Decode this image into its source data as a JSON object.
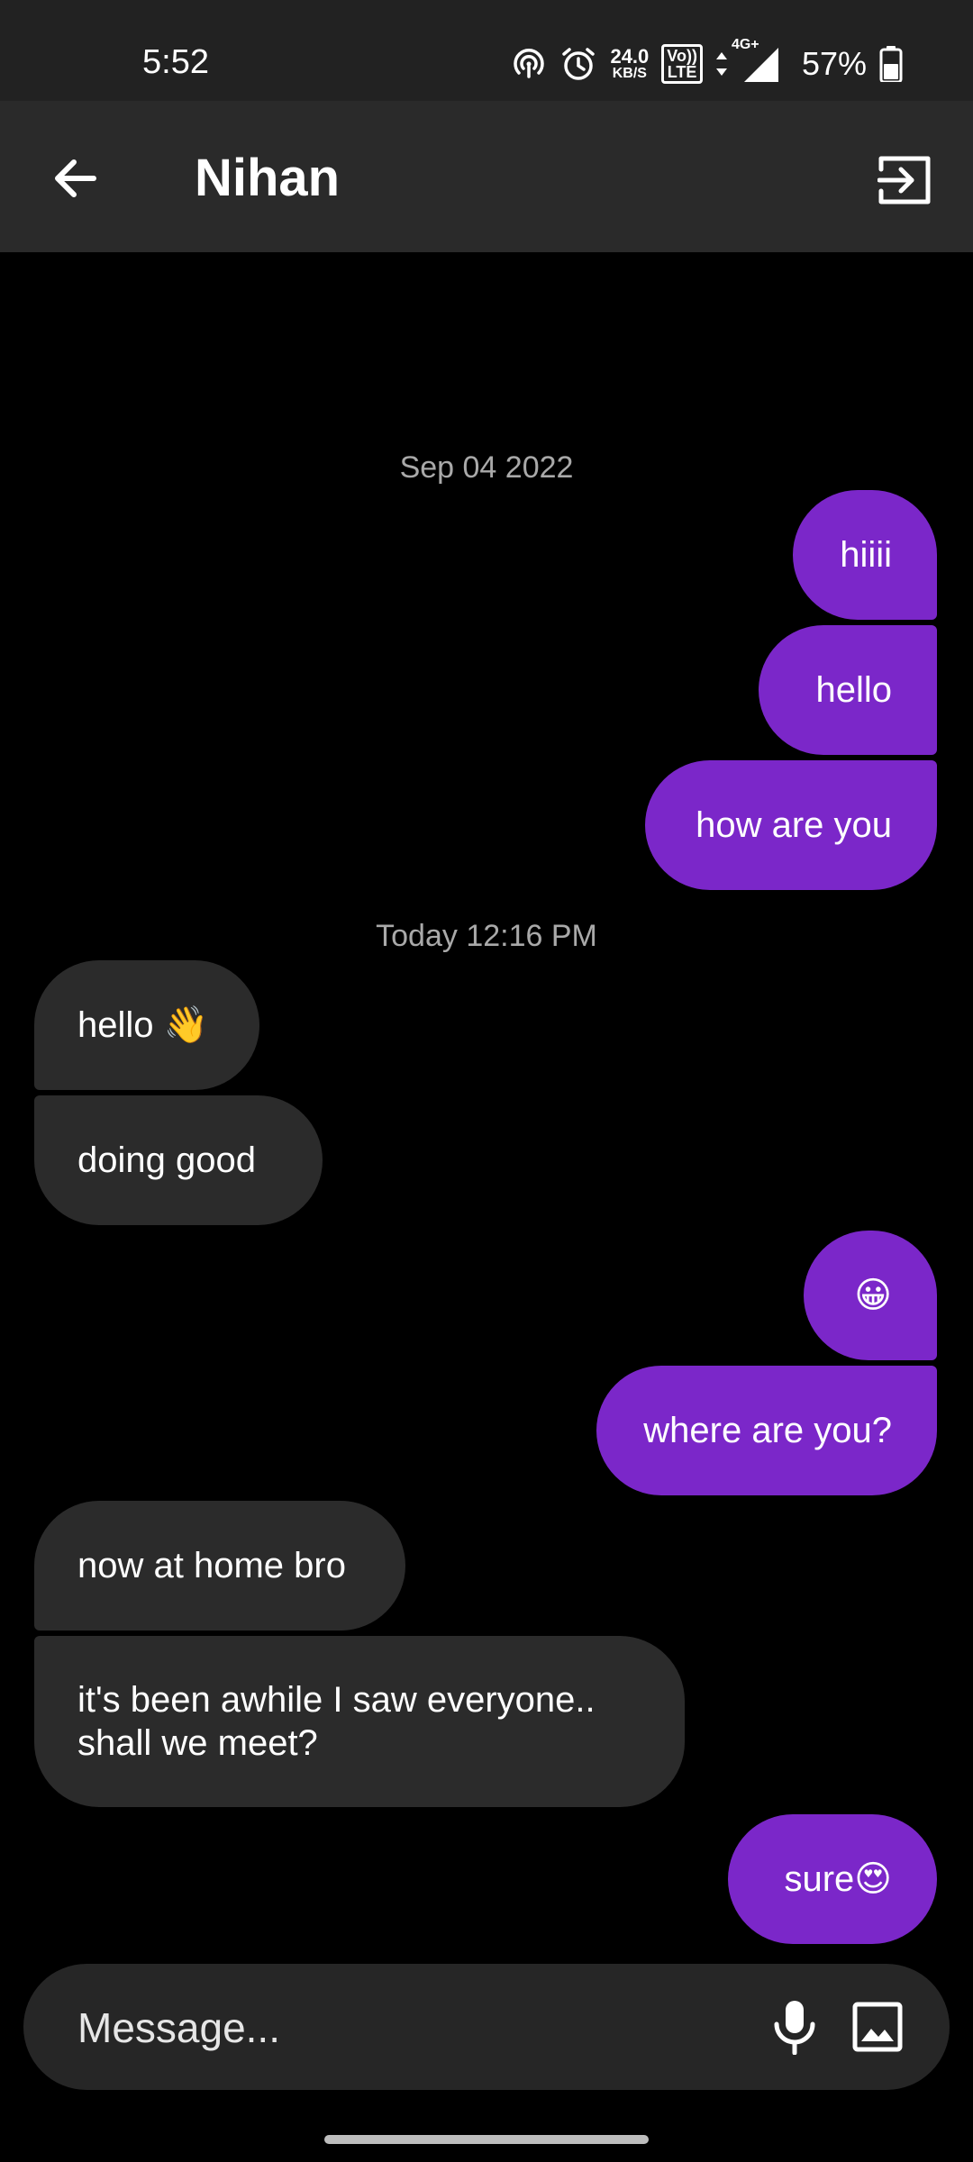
{
  "status_bar": {
    "time": "5:52",
    "net_speed_value": "24.0",
    "net_speed_unit": "KB/S",
    "volte_top": "Vo))",
    "volte_bottom": "LTE",
    "network_type": "4G+",
    "battery_percent": "57%",
    "icons": [
      "hotspot-icon",
      "alarm-icon",
      "volte-icon",
      "data-arrows-icon",
      "signal-icon",
      "battery-icon"
    ]
  },
  "header": {
    "contact_name": "Nihan",
    "back_icon": "arrow-left-icon",
    "exit_icon": "exit-icon"
  },
  "conversation": {
    "date_separators": [
      "Sep 04 2022",
      "Today 12:16 PM"
    ],
    "messages": [
      {
        "direction": "outgoing",
        "text": "hiiii"
      },
      {
        "direction": "outgoing",
        "text": "hello"
      },
      {
        "direction": "outgoing",
        "text": "how are you"
      },
      {
        "direction": "incoming",
        "text": "hello 👋"
      },
      {
        "direction": "incoming",
        "text": "doing good"
      },
      {
        "direction": "outgoing",
        "text": "😀"
      },
      {
        "direction": "outgoing",
        "text": "where are you?"
      },
      {
        "direction": "incoming",
        "text": "now at home bro"
      },
      {
        "direction": "incoming",
        "text": "it's been awhile I saw everyone..\nshall we meet?"
      },
      {
        "direction": "outgoing",
        "text": "sure😍"
      }
    ]
  },
  "composer": {
    "placeholder": "Message...",
    "mic_icon": "microphone-icon",
    "image_icon": "image-icon"
  },
  "colors": {
    "background": "#000000",
    "header_background": "#2a2a2a",
    "outgoing_bubble": "#7b27c9",
    "incoming_bubble": "#2b2b2b",
    "date_text": "#a9a9a9",
    "composer_background": "#262626"
  }
}
